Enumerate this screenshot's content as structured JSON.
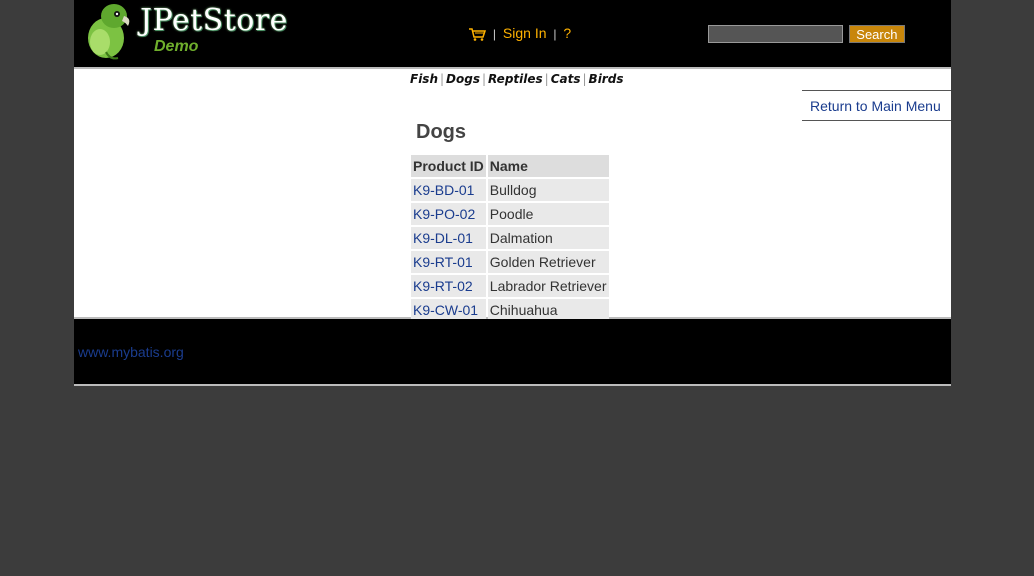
{
  "header": {
    "logo_title": "JPetStore",
    "logo_subtitle": "Demo",
    "sign_in": "Sign In",
    "help": "?",
    "separator": "|",
    "search_button": "Search",
    "search_value": ""
  },
  "quick_links": [
    "Fish",
    "Dogs",
    "Reptiles",
    "Cats",
    "Birds"
  ],
  "back_link": "Return to Main Menu",
  "category_title": "Dogs",
  "table": {
    "headers": [
      "Product ID",
      "Name"
    ],
    "rows": [
      [
        "K9-BD-01",
        "Bulldog"
      ],
      [
        "K9-PO-02",
        "Poodle"
      ],
      [
        "K9-DL-01",
        "Dalmation"
      ],
      [
        "K9-RT-01",
        "Golden Retriever"
      ],
      [
        "K9-RT-02",
        "Labrador Retriever"
      ],
      [
        "K9-CW-01",
        "Chihuahua"
      ]
    ]
  },
  "footer": {
    "link": "www.mybatis.org"
  },
  "colors": {
    "header_bg": "#000000",
    "accent": "#ffb200",
    "link": "#1a3c8e",
    "page_bg": "#3c3c3c"
  }
}
